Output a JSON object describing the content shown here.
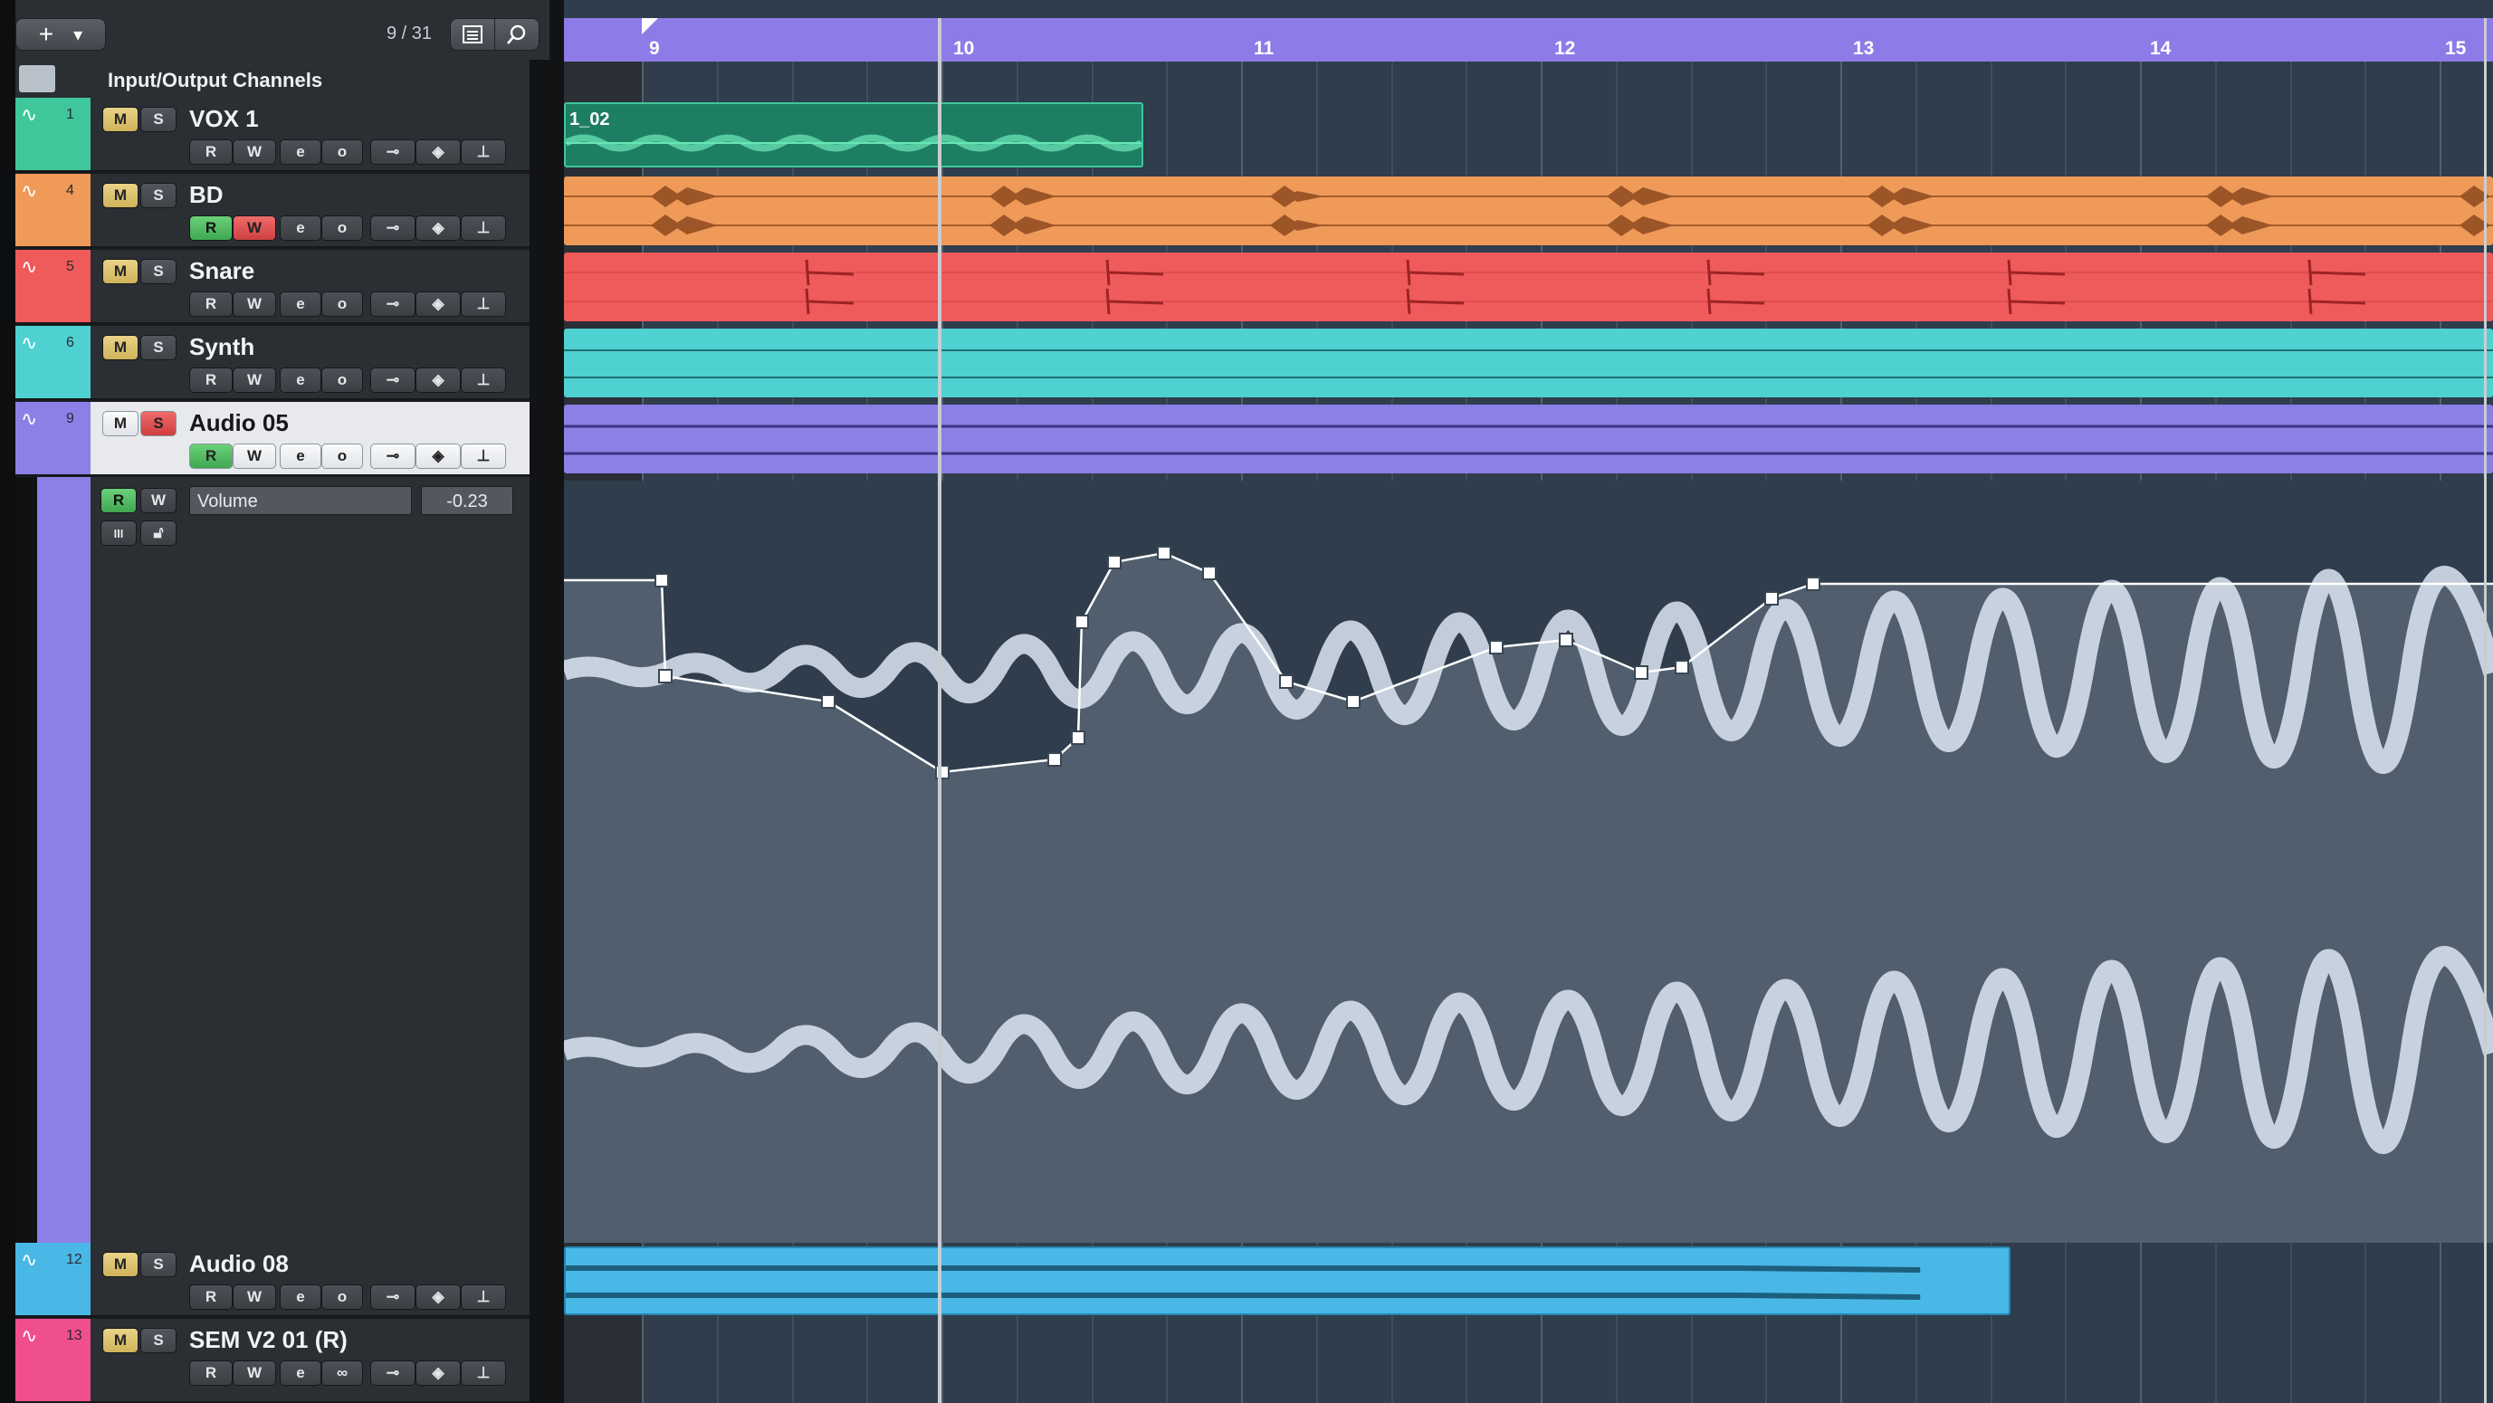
{
  "toolbar": {
    "add_label": "+",
    "dropdown_label": "▾",
    "counter": "9 / 31"
  },
  "header": {
    "label": "Input/Output Channels"
  },
  "tracks": [
    {
      "number": "1",
      "name": "VOX 1"
    },
    {
      "number": "4",
      "name": "BD"
    },
    {
      "number": "5",
      "name": "Snare"
    },
    {
      "number": "6",
      "name": "Synth"
    },
    {
      "number": "9",
      "name": "Audio 05"
    },
    {
      "number": "12",
      "name": "Audio 08"
    },
    {
      "number": "13",
      "name": "SEM V2 01 (R)"
    }
  ],
  "buttons": {
    "mute": "M",
    "solo": "S",
    "read": "R",
    "write": "W",
    "edit": "e",
    "monitor": "o",
    "monitor_link": "∞",
    "lanes": "III"
  },
  "automation": {
    "parameter": "Volume",
    "value": "-0.23"
  },
  "ruler": {
    "bars": [
      "9",
      "10",
      "11",
      "12",
      "13",
      "14",
      "15"
    ]
  },
  "events": {
    "vox_label": "1_02"
  },
  "colors": {
    "vox": "#3fc79b",
    "bd": "#f09a5a",
    "snare": "#ef5a5a",
    "synth": "#4fd1d1",
    "audio05": "#8c80e6",
    "audio08": "#49b8e6",
    "sem": "#ef4f8e",
    "ruler": "#8e7be8",
    "mute_on": "#e0c46e",
    "solo_on": "#e05151",
    "read_on": "#52bf63"
  }
}
